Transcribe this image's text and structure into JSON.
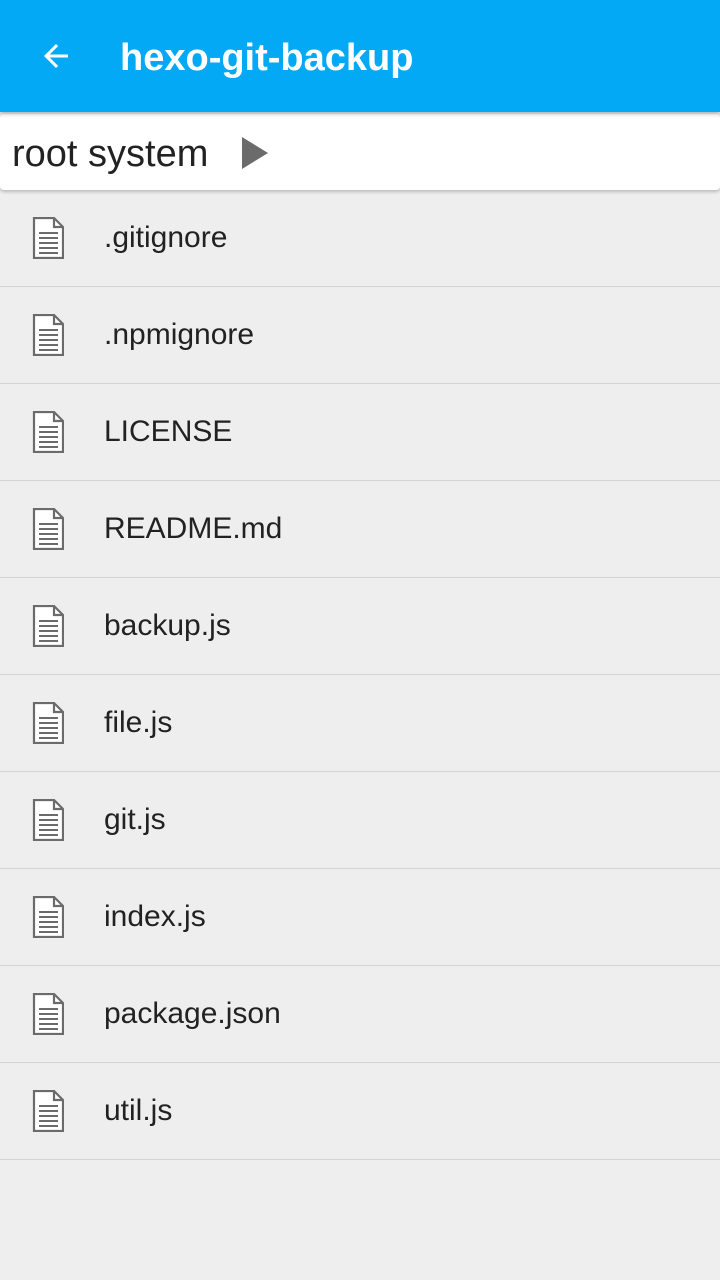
{
  "app_bar": {
    "title": "hexo-git-backup",
    "background_color": "#03a9f4",
    "back_icon": "arrow-back-icon"
  },
  "breadcrumb": {
    "items": [
      {
        "label": "root system"
      }
    ],
    "separator_icon": "play-arrow-icon"
  },
  "file_list": {
    "item_icon": "file-document-icon",
    "items": [
      {
        "name": ".gitignore"
      },
      {
        "name": ".npmignore"
      },
      {
        "name": "LICENSE"
      },
      {
        "name": "README.md"
      },
      {
        "name": "backup.js"
      },
      {
        "name": "file.js"
      },
      {
        "name": "git.js"
      },
      {
        "name": "index.js"
      },
      {
        "name": "package.json"
      },
      {
        "name": "util.js"
      }
    ]
  }
}
